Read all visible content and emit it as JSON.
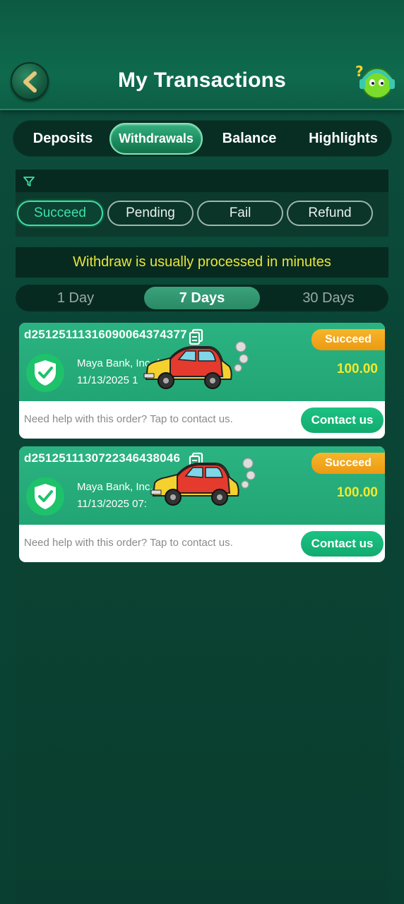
{
  "header": {
    "title": "My Transactions",
    "back_icon": "chevron-left-icon",
    "support_icon": "customer-support-mascot-icon"
  },
  "tabs": [
    {
      "label": "Deposits",
      "active": false
    },
    {
      "label": "Withdrawals",
      "active": true
    },
    {
      "label": "Balance",
      "active": false
    },
    {
      "label": "Highlights",
      "active": false
    }
  ],
  "filter": {
    "icon": "filter-icon",
    "statuses": [
      {
        "label": "Succeed",
        "active": true
      },
      {
        "label": "Pending",
        "active": false
      },
      {
        "label": "Fail",
        "active": false
      },
      {
        "label": "Refund",
        "active": false
      }
    ]
  },
  "notice": "Withdraw is usually processed in minutes",
  "periods": [
    {
      "label": "1 Day",
      "active": false
    },
    {
      "label": "7 Days",
      "active": true
    },
    {
      "label": "30 Days",
      "active": false
    }
  ],
  "transactions": [
    {
      "order_id": "d25125111316090064374377",
      "status": "Succeed",
      "bank": "Maya Bank, Inc. (09",
      "date": "11/13/2025 1",
      "amount": "100.00",
      "help_text": "Need help with this order? Tap to contact us.",
      "contact_label": "Contact us"
    },
    {
      "order_id": "d2512511130722346438046",
      "status": "Succeed",
      "bank": "Maya Bank, Inc.",
      "date": "11/13/2025 07:",
      "amount": "100.00",
      "help_text": "Need help with this order? Tap to contact us.",
      "contact_label": "Contact us"
    }
  ],
  "colors": {
    "accent_green": "#2bb382",
    "highlight_yellow": "#e8e53a",
    "badge_orange": "#f0a41a",
    "amount_yellow": "#f2e92e"
  }
}
